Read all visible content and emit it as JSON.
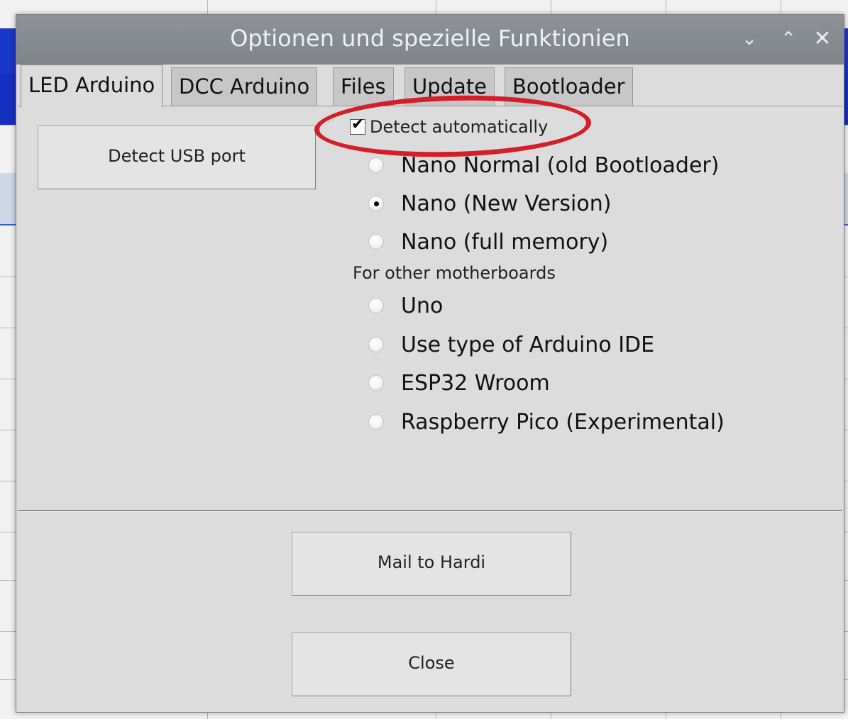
{
  "window": {
    "title": "Optionen und spezielle Funktionien",
    "minimize_glyph": "⌄",
    "maximize_glyph": "⌃",
    "close_glyph": "✕"
  },
  "tabs": [
    {
      "label": "LED Arduino",
      "active": true
    },
    {
      "label": "DCC Arduino",
      "active": false
    },
    {
      "label": "Files",
      "active": false
    },
    {
      "label": "Update",
      "active": false
    },
    {
      "label": "Bootloader",
      "active": false
    }
  ],
  "led_tab": {
    "detect_usb_button": "Detect USB port",
    "detect_automatically": {
      "label": "Detect automatically",
      "checked": true
    },
    "nano_options": [
      {
        "label": "Nano Normal (old Bootloader)",
        "selected": false
      },
      {
        "label": "Nano (New Version)",
        "selected": true
      },
      {
        "label": "Nano (full memory)",
        "selected": false
      }
    ],
    "other_boards_label": "For other motherboards",
    "other_options": [
      {
        "label": "Uno",
        "selected": false
      },
      {
        "label": "Use type of Arduino IDE",
        "selected": false
      },
      {
        "label": "ESP32 Wroom",
        "selected": false
      },
      {
        "label": "Raspberry Pico (Experimental)",
        "selected": false
      }
    ]
  },
  "footer": {
    "mail_button": "Mail to Hardi",
    "close_button": "Close"
  },
  "colors": {
    "highlight_ring": "#d41f2b",
    "titlebar": "#868a90"
  }
}
